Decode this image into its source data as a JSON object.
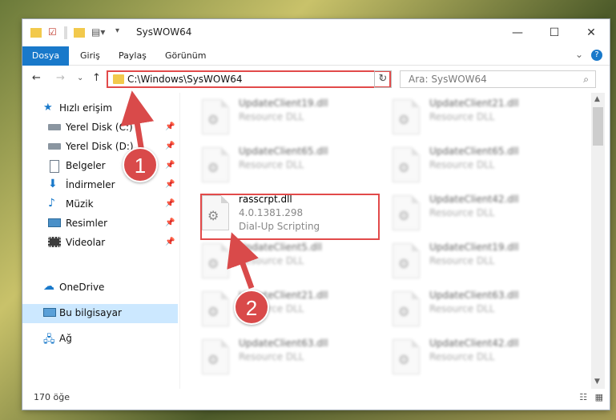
{
  "window": {
    "title": "SysWOW64",
    "minimize": "—",
    "maximize": "☐",
    "close": "✕"
  },
  "ribbon": {
    "tabs": [
      "Dosya",
      "Giriş",
      "Paylaş",
      "Görünüm"
    ],
    "expand": "⌄",
    "help": "?"
  },
  "nav": {
    "back": "←",
    "forward": "→",
    "recent": "⌄",
    "up": "↑",
    "address": "C:\\Windows\\SysWOW64",
    "dropdown": "⌄",
    "refresh": "↻",
    "search_placeholder": "Ara: SysWOW64",
    "search_icon": "⌕"
  },
  "sidebar": {
    "quick_access": "Hızlı erişim",
    "items": [
      {
        "label": "Yerel Disk (C:)",
        "icon": "drive-icon",
        "pinned": true
      },
      {
        "label": "Yerel Disk (D:)",
        "icon": "drive-icon",
        "pinned": true
      },
      {
        "label": "Belgeler",
        "icon": "documents-icon",
        "pinned": true
      },
      {
        "label": "İndirmeler",
        "icon": "downloads-icon",
        "pinned": true
      },
      {
        "label": "Müzik",
        "icon": "music-icon",
        "pinned": true
      },
      {
        "label": "Resimler",
        "icon": "pictures-icon",
        "pinned": true
      },
      {
        "label": "Videolar",
        "icon": "videos-icon",
        "pinned": true
      }
    ],
    "onedrive": "OneDrive",
    "this_pc": "Bu bilgisayar",
    "network": "Ağ"
  },
  "files": {
    "left": [
      {
        "name": "UpdateClient19.dll",
        "type": "Resource DLL"
      },
      {
        "name": "UpdateClient65.dll",
        "type": "Resource DLL"
      },
      {
        "name": "rasscrpt.dll",
        "version": "4.0.1381.298",
        "desc": "Dial-Up Scripting"
      },
      {
        "name": "UpdateClient5.dll",
        "type": "Resource DLL"
      },
      {
        "name": "UpdateClient21.dll",
        "type": "Resource DLL"
      },
      {
        "name": "UpdateClient63.dll",
        "type": "Resource DLL"
      }
    ],
    "right": [
      {
        "name": "UpdateClient21.dll",
        "type": "Resource DLL"
      },
      {
        "name": "UpdateClient65.dll",
        "type": "Resource DLL"
      },
      {
        "name": "UpdateClient42.dll",
        "type": "Resource DLL"
      },
      {
        "name": "UpdateClient19.dll",
        "type": "Resource DLL"
      },
      {
        "name": "UpdateClient63.dll",
        "type": "Resource DLL"
      },
      {
        "name": "UpdateClient42.dll",
        "type": "Resource DLL"
      }
    ]
  },
  "status": {
    "count": "170 öğe"
  },
  "annotations": {
    "step1": "1",
    "step2": "2",
    "accent": "#d94a4a"
  }
}
